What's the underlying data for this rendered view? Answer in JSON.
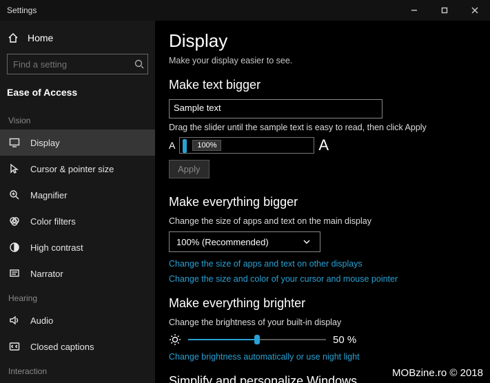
{
  "window": {
    "title": "Settings"
  },
  "sidebar": {
    "home": "Home",
    "search_placeholder": "Find a setting",
    "category": "Ease of Access",
    "groups": {
      "vision": "Vision",
      "hearing": "Hearing",
      "interaction": "Interaction"
    },
    "items": {
      "display": "Display",
      "cursor": "Cursor & pointer size",
      "magnifier": "Magnifier",
      "colorfilters": "Color filters",
      "highcontrast": "High contrast",
      "narrator": "Narrator",
      "audio": "Audio",
      "closedcaptions": "Closed captions"
    }
  },
  "page": {
    "title": "Display",
    "subtitle": "Make your display easier to see."
  },
  "text_bigger": {
    "heading": "Make text bigger",
    "sample": "Sample text",
    "instruction": "Drag the slider until the sample text is easy to read, then click Apply",
    "percent": "100%",
    "apply": "Apply"
  },
  "everything_bigger": {
    "heading": "Make everything bigger",
    "desc": "Change the size of apps and text on the main display",
    "selected": "100% (Recommended)",
    "link1": "Change the size of apps and text on other displays",
    "link2": "Change the size and color of your cursor and mouse pointer"
  },
  "brighter": {
    "heading": "Make everything brighter",
    "desc": "Change the brightness of your built-in display",
    "value": "50 %",
    "link": "Change brightness automatically or use night light"
  },
  "simplify": {
    "heading": "Simplify and personalize Windows"
  },
  "watermark": "MOBzine.ro © 2018"
}
